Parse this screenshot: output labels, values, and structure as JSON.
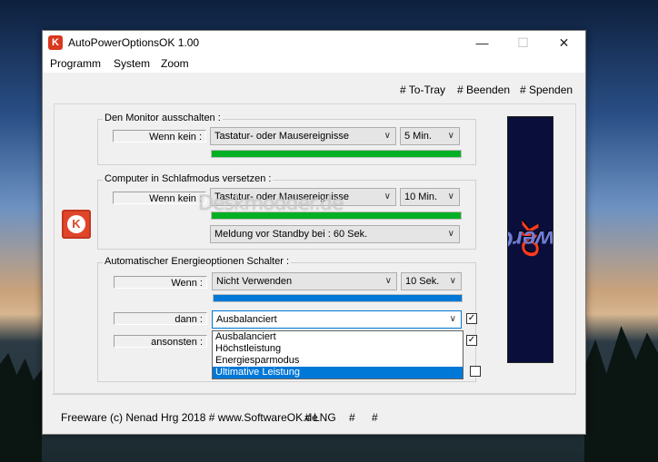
{
  "window": {
    "title": "AutoPowerOptionsOK 1.00",
    "app_icon_glyph": "K",
    "minimize": "—",
    "maximize": "☐",
    "close": "✕"
  },
  "menu": [
    "Programm",
    "System",
    "Zoom"
  ],
  "toolbar_links": [
    "# To-Tray",
    "# Beenden",
    "# Spenden"
  ],
  "monitor": {
    "label": "Den Monitor ausschalten :",
    "when_label": "Wenn kein :",
    "event": "Tastatur- oder Mausereignisse",
    "time": "5 Min.",
    "progress": 1.0,
    "progress_color": "#06b025"
  },
  "sleep": {
    "label": "Computer in Schlafmodus versetzen :",
    "when_label": "Wenn kein :",
    "event": "Tastatur- oder Mausereignisse",
    "time": "10 Min.",
    "progress": 1.0,
    "progress_color": "#06b025",
    "message": "Meldung vor Standby bei : 60 Sek."
  },
  "energy": {
    "label": "Automatischer Energieoptionen Schalter :",
    "when_label": "Wenn :",
    "when_value": "Nicht Verwenden",
    "time": "10 Sek.",
    "progress": 1.0,
    "progress_color": "#0078d7",
    "then_label": "dann :",
    "then_value": "Ausbalanciert",
    "else_label": "ansonsten :",
    "dropdown_options": [
      "Ausbalanciert",
      "Höchstleistung",
      "Energiesparmodus",
      "Ultimative Leistung"
    ],
    "selected_option": "Ultimative Leistung"
  },
  "banner": {
    "part1": "AutoPowerOptions",
    "part2": "OK"
  },
  "watermark": "Deskmodder.de",
  "footer": [
    "Freeware (c) Nenad Hrg 2018 # www.SoftwareOK.de",
    "# LNG",
    "#",
    "#"
  ]
}
